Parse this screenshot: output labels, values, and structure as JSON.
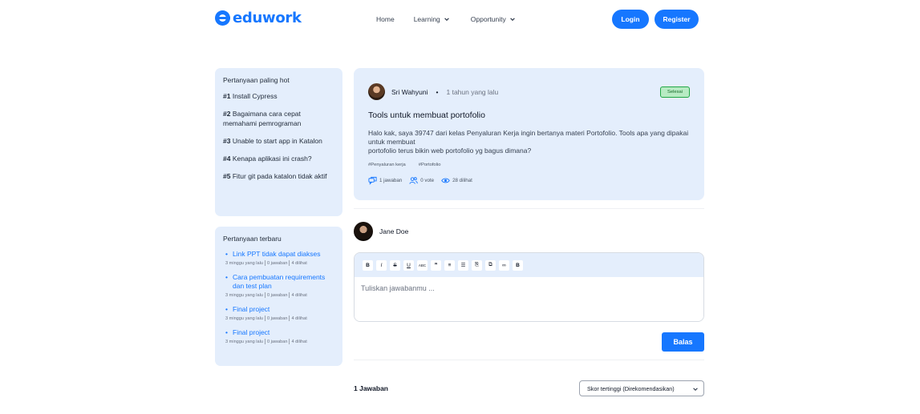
{
  "brand": {
    "name": "eduwork",
    "color": "#1677ff"
  },
  "nav": {
    "links": [
      {
        "label": "Home"
      },
      {
        "label": "Learning",
        "icon": "chevron-down-icon"
      },
      {
        "label": "Opportunity",
        "icon": "chevron-down-icon"
      }
    ],
    "login_label": "Login",
    "register_label": "Register"
  },
  "sidebar": {
    "hot": {
      "title": "Pertanyaan paling hot",
      "items": [
        {
          "rank": "#1",
          "text": "Install Cypress"
        },
        {
          "rank": "#2",
          "text": "Bagaimana cara cepat memahami pemrograman"
        },
        {
          "rank": "#3",
          "text": "Unable to start app in Katalon"
        },
        {
          "rank": "#4",
          "text": "Kenapa aplikasi ini crash?"
        },
        {
          "rank": "#5",
          "text": "Fitur git pada katalon tidak aktif"
        }
      ]
    },
    "newest": {
      "title": "Pertanyaan terbaru",
      "items": [
        {
          "title": "Link PPT tidak dapat diakses",
          "time": "3 minggu yang lalu",
          "answers": "0 jawaban",
          "views": "4 dilihat"
        },
        {
          "title": "Cara pembuatan requirements dan test plan",
          "time": "3 minggu yang lalu",
          "answers": "0 jawaban",
          "views": "4 dilihat"
        },
        {
          "title": "Final project",
          "time": "3 minggu yang lalu",
          "answers": "0 jawaban",
          "views": "4 dilihat"
        },
        {
          "title": "Final project",
          "time": "3 minggu yang lalu",
          "answers": "0 jawaban",
          "views": "4 dilihat"
        }
      ]
    }
  },
  "question": {
    "author": "Sri Wahyuni",
    "time": "1 tahun yang lalu",
    "status": "Selesai",
    "title": "Tools untuk membuat portofolio",
    "body_line1": "Halo kak, saya 39747 dari kelas Penyaluran Kerja ingin bertanya materi Portofolio. Tools apa yang dipakai untuk membuat",
    "body_line2": "portofolio terus bikin web portofolio yg bagus dimana?",
    "tags": [
      "#Penyaluran kerja",
      "#Portofolio"
    ],
    "stats": {
      "answers": "1 jawaban",
      "votes": "0 vote",
      "views": "28 dilihat"
    }
  },
  "answer_form": {
    "user": "Jane Doe",
    "toolbar": [
      "B",
      "I",
      "S",
      "U",
      "ABC",
      "❞",
      "≡",
      "☰",
      "⎘",
      "⧉",
      "∞",
      "B"
    ],
    "placeholder": "Tuliskan jawabanmu ...",
    "submit_label": "Balas"
  },
  "answers_section": {
    "count_label": "1 Jawaban",
    "sort_selected": "Skor tertinggi (Direkomendasikan)"
  }
}
